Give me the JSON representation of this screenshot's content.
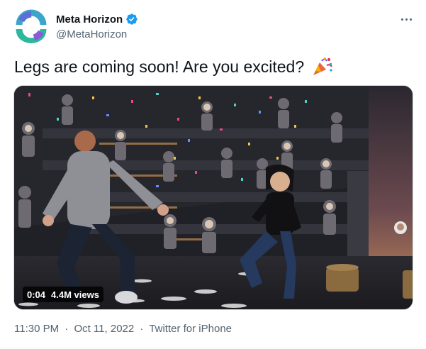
{
  "author": {
    "display_name": "Meta Horizon",
    "handle": "@MetaHorizon",
    "verified": true,
    "avatar_icon": "meta-horizon-logo-icon"
  },
  "tweet": {
    "text": "Legs are coming soon! Are you excited?",
    "emoji_icon": "party-popper-icon"
  },
  "media": {
    "duration": "0:04",
    "views": "4.4M views"
  },
  "meta": {
    "time": "11:30 PM",
    "separator_1": "·",
    "date": "Oct 11, 2022",
    "separator_2": "·",
    "source": "Twitter for iPhone"
  },
  "colors": {
    "verified": "#1d9bf0",
    "secondary_text": "#536471",
    "logo_teal": "#21a89a",
    "logo_purple": "#6a5acd"
  }
}
